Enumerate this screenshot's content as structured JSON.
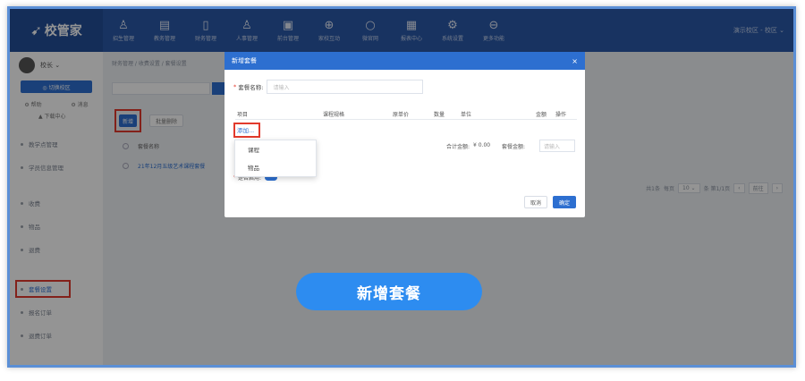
{
  "app": {
    "logo_text": "校管家",
    "nav_items": [
      {
        "icon": "person-icon",
        "glyph": "♙",
        "label": "招生管理"
      },
      {
        "icon": "chart-icon",
        "glyph": "▤",
        "label": "教务管理"
      },
      {
        "icon": "wallet-icon",
        "glyph": "▯",
        "label": "财务管理"
      },
      {
        "icon": "user-icon",
        "glyph": "♙",
        "label": "人事管理"
      },
      {
        "icon": "box-icon",
        "glyph": "▣",
        "label": "前台管理"
      },
      {
        "icon": "gift-icon",
        "glyph": "⊕",
        "label": "家校互动"
      },
      {
        "icon": "circle-icon",
        "glyph": "○",
        "label": "微官网"
      },
      {
        "icon": "report-icon",
        "glyph": "▦",
        "label": "报表中心"
      },
      {
        "icon": "gear-icon",
        "glyph": "⚙",
        "label": "系统设置"
      },
      {
        "icon": "more-icon",
        "glyph": "⊖",
        "label": "更多功能"
      }
    ],
    "top_right_text": "演示校区 - 校区 ⌄"
  },
  "sidebar": {
    "user_name": "校长 ⌄",
    "switch_label": "◎ 切换校区",
    "quick_links": [
      "⚙ 帮助",
      "⚙ 消息"
    ],
    "download_label": "▲ 下载中心",
    "items": [
      {
        "label": "教学点管理",
        "active": false
      },
      {
        "label": "学员信息管理",
        "active": false
      },
      {
        "label": "收费",
        "active": false
      },
      {
        "label": "物品",
        "active": false
      },
      {
        "label": "退费",
        "active": false
      },
      {
        "label": "套餐设置",
        "active": true
      },
      {
        "label": "报名订单",
        "active": false
      },
      {
        "label": "退费订单",
        "active": false
      }
    ],
    "footer_label": "▯ 收起"
  },
  "main": {
    "breadcrumb": "财务管理 / 收费设置 / 套餐设置",
    "search_placeholder": "请输入套餐名称",
    "add_button": "新增",
    "batch_delete_button": "批量删除",
    "list_header": "套餐名称",
    "list_row": "21年12月五级艺术课程套餐",
    "pagination": {
      "total": "共1条",
      "per_page_label": "每页",
      "per_page": "10 ⌄",
      "page_info": "条 第1/1页",
      "prev": "‹",
      "next": "›",
      "goto_label": "前往"
    }
  },
  "modal": {
    "title": "新增套餐",
    "close_glyph": "×",
    "name_label": "套餐名称:",
    "name_placeholder": "请输入",
    "columns": [
      "项目",
      "课程规格",
      "原单价",
      "数量",
      "单位",
      "金额",
      "操作"
    ],
    "add_link": "添加...",
    "total_label": "合计金额:",
    "total_value": "¥ 0.00",
    "package_amount_label": "套餐金额:",
    "package_amount_placeholder": "请输入",
    "enable_label": "是否启用:",
    "cancel_label": "取消",
    "confirm_label": "确定"
  },
  "dropdown": {
    "options": [
      "课程",
      "物品"
    ]
  },
  "banner": {
    "text": "新增套餐"
  },
  "colors": {
    "primary": "#2d6fd0",
    "topbar": "#2a58a8",
    "highlight_red": "#e23a2d",
    "banner": "#2d8cf0"
  }
}
